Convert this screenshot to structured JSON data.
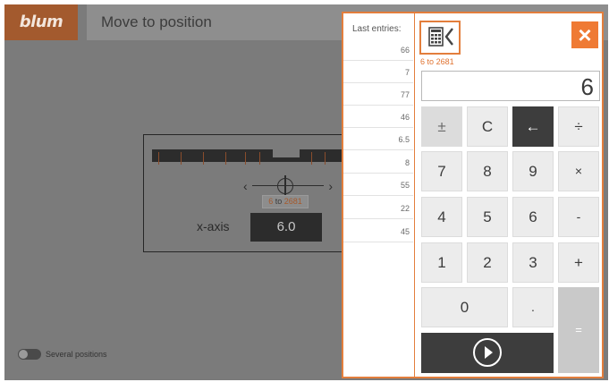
{
  "header": {
    "logo_text": "blum",
    "title": "Move to position"
  },
  "workspace": {
    "range_from": "6",
    "range_to_word": "to",
    "range_to": "2681",
    "axis_label": "x-axis",
    "axis_value": "6.0",
    "several_positions_label": "Several positions",
    "several_positions_enabled": false
  },
  "calculator": {
    "last_entries_label": "Last entries:",
    "last_entries": [
      "66",
      "7",
      "77",
      "46",
      "6.5",
      "8",
      "55",
      "22",
      "45"
    ],
    "range_from": "6",
    "range_to_word": "to",
    "range_to": "2681",
    "display_value": "6",
    "close_icon": "×",
    "keys": {
      "plus_minus": "±",
      "clear": "C",
      "backspace": "←",
      "divide": "÷",
      "seven": "7",
      "eight": "8",
      "nine": "9",
      "multiply": "×",
      "four": "4",
      "five": "5",
      "six": "6",
      "minus": "-",
      "one": "1",
      "two": "2",
      "three": "3",
      "plus": "+",
      "zero": "0",
      "decimal": ".",
      "equals": "="
    },
    "colors": {
      "accent": "#ef7a34",
      "dark_key": "#3d3d3d"
    }
  }
}
